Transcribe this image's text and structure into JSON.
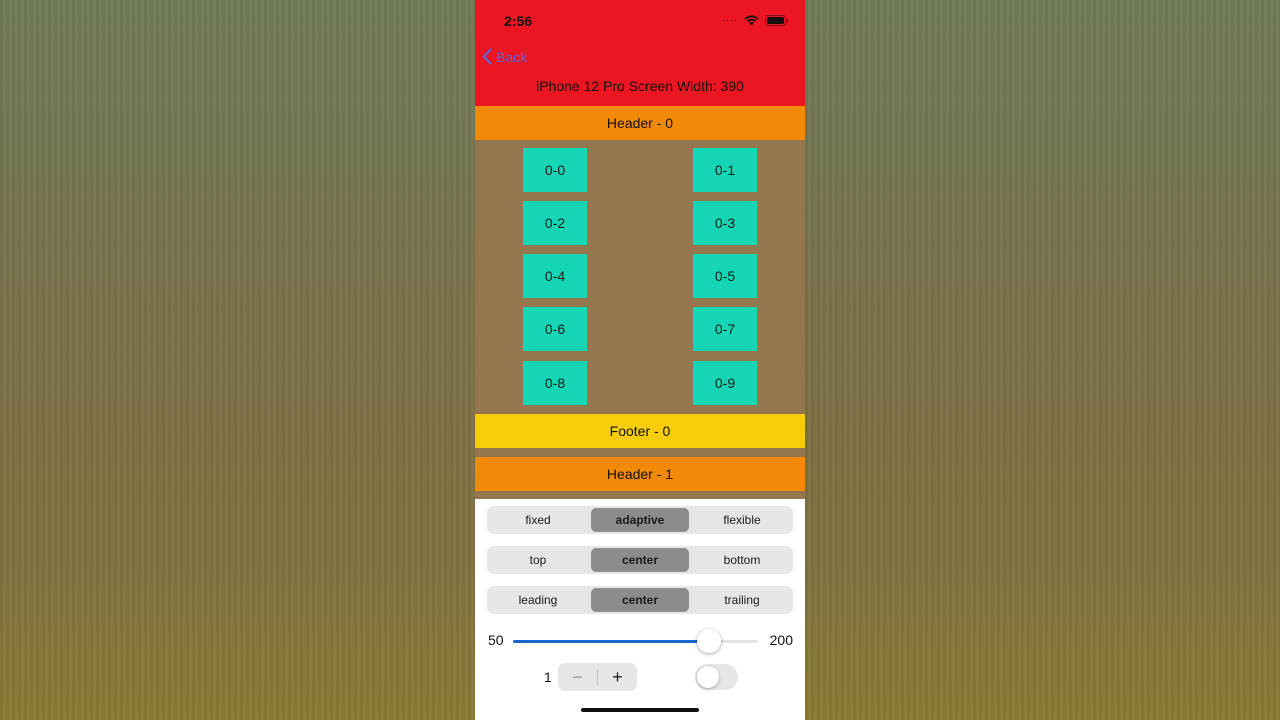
{
  "status_bar": {
    "time": "2:56",
    "signal": "····"
  },
  "nav": {
    "back_label": "Back",
    "title": "iPhone 12 Pro Screen Width: 390"
  },
  "sections": [
    {
      "header": "Header - 0",
      "items": [
        "0-0",
        "0-1",
        "0-2",
        "0-3",
        "0-4",
        "0-5",
        "0-6",
        "0-7",
        "0-8",
        "0-9"
      ],
      "footer": "Footer - 0"
    },
    {
      "header": "Header - 1"
    }
  ],
  "controls": {
    "grid_item_type": {
      "options": [
        "fixed",
        "adaptive",
        "flexible"
      ],
      "selected": "adaptive"
    },
    "vertical_alignment": {
      "options": [
        "top",
        "center",
        "bottom"
      ],
      "selected": "center"
    },
    "horizontal_alignment": {
      "options": [
        "leading",
        "center",
        "trailing"
      ],
      "selected": "center"
    },
    "slider": {
      "min_label": "50",
      "max_label": "200",
      "min": 50,
      "max": 200,
      "value": 170
    },
    "stepper": {
      "value": "1",
      "minus": "−",
      "plus": "+"
    },
    "toggle": {
      "on": false
    }
  },
  "colors": {
    "nav_background": "#ec1522",
    "header_background": "#f28a08",
    "footer_background": "#f7cc08",
    "grid_background": "#94774f",
    "cell_background": "#14d6b4",
    "accent": "#1a66cc"
  }
}
